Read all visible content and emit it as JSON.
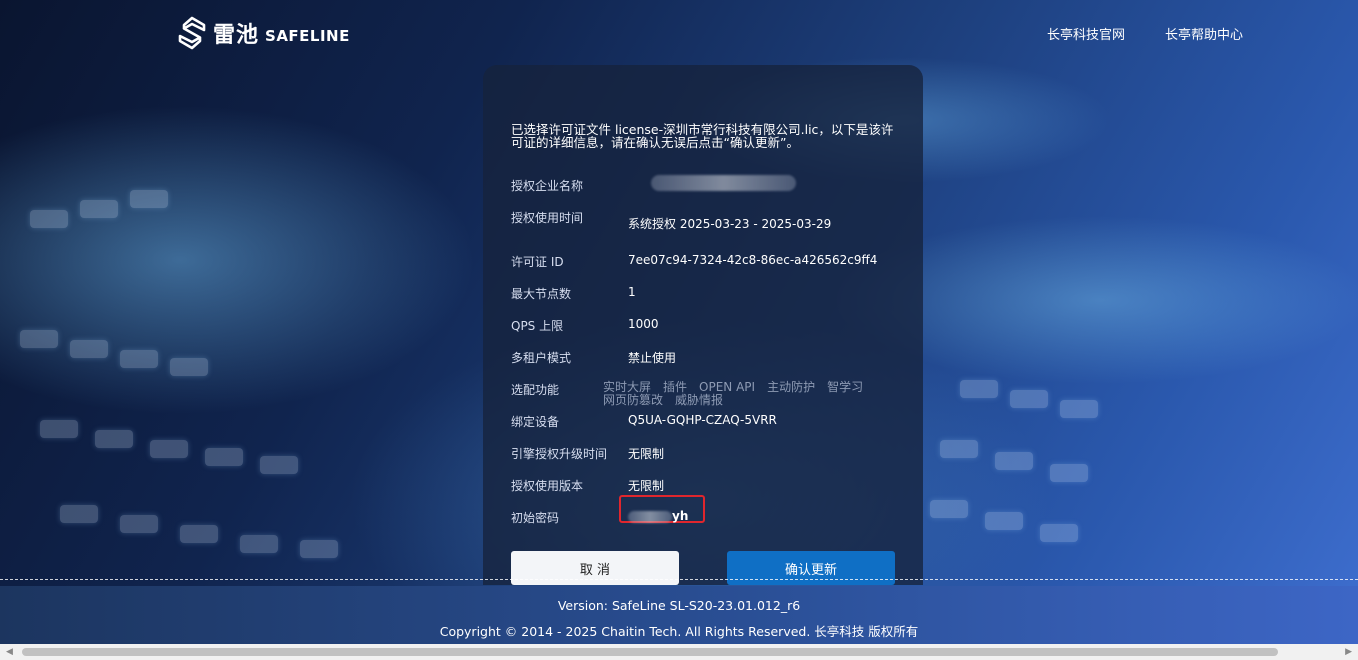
{
  "brand": {
    "name_cn": "雷池",
    "name_en": "SAFELINE"
  },
  "nav": {
    "items": [
      "长亭科技官网",
      "长亭帮助中心"
    ]
  },
  "license": {
    "intro": "已选择许可证文件 license-深圳市常行科技有限公司.lic，以下是该许可证的详细信息，请在确认无误后点击“确认更新”。",
    "fields": {
      "company_label": "授权企业名称",
      "time_label": "授权使用时间",
      "time_value": "系统授权 2025-03-23 - 2025-03-29",
      "id_label": "许可证 ID",
      "id_value": "7ee07c94-7324-42c8-86ec-a426562c9ff4",
      "nodes_label": "最大节点数",
      "nodes_value": "1",
      "qps_label": "QPS 上限",
      "qps_value": "1000",
      "tenant_label": "多租户模式",
      "tenant_value": "禁止使用",
      "features_label": "选配功能",
      "features": [
        "实时大屏",
        "插件",
        "OPEN API",
        "主动防护",
        "智学习",
        "网页防篡改",
        "威胁情报"
      ],
      "device_label": "绑定设备",
      "device_value": "Q5UA-GQHP-CZAQ-5VRR",
      "engine_label": "引擎授权升级时间",
      "engine_value": "无限制",
      "version_label": "授权使用版本",
      "version_value": "无限制",
      "pwd_label": "初始密码",
      "pwd_visible": "yh"
    },
    "cancel_label": "取 消",
    "confirm_label": "确认更新"
  },
  "footer": {
    "version": "Version: SafeLine SL-S20-23.01.012_r6",
    "copyright": "Copyright © 2014 - 2025 Chaitin Tech. All Rights Reserved. 长亭科技 版权所有"
  },
  "colors": {
    "confirm_button": "#0f6fc5",
    "highlight_box": "#e0262d"
  }
}
